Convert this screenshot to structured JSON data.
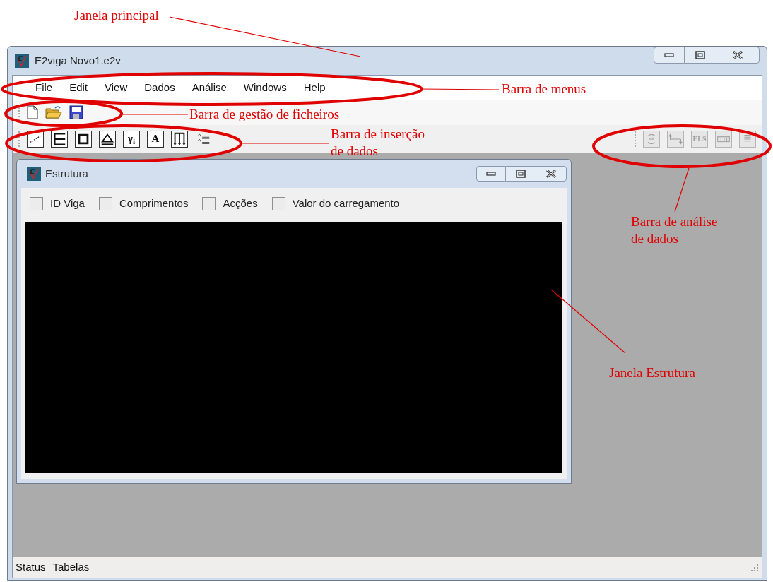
{
  "window": {
    "title": "E2viga  Novo1.e2v"
  },
  "menu": [
    "File",
    "Edit",
    "View",
    "Dados",
    "Análise",
    "Windows",
    "Help"
  ],
  "file_toolbar": [
    {
      "kind": "new"
    },
    {
      "kind": "open"
    },
    {
      "kind": "save"
    }
  ],
  "data_toolbar": [
    {
      "kind": "line"
    },
    {
      "kind": "frame"
    },
    {
      "kind": "support"
    },
    {
      "kind": "triangle"
    },
    {
      "kind": "text",
      "label": "γ$_{i}$"
    },
    {
      "kind": "text",
      "label": "A"
    },
    {
      "kind": "loads"
    },
    {
      "kind": "lines"
    }
  ],
  "analysis_toolbar": [
    {
      "kind": "cycle",
      "disabled": true
    },
    {
      "kind": "span",
      "disabled": true
    },
    {
      "kind": "text",
      "label": "ELS",
      "disabled": true
    },
    {
      "kind": "table",
      "disabled": true
    },
    {
      "kind": "list",
      "disabled": true
    }
  ],
  "child_window": {
    "title": "Estrutura",
    "checkboxes": [
      {
        "label": "ID Viga",
        "checked": false
      },
      {
        "label": "Comprimentos",
        "checked": false
      },
      {
        "label": "Acções",
        "checked": false
      },
      {
        "label": "Valor do carregamento",
        "checked": false
      }
    ]
  },
  "status_bar": [
    "Status",
    "Tabelas"
  ],
  "annotations": [
    {
      "lines": [
        "Janela principal"
      ]
    },
    {
      "lines": [
        "Barra de menus"
      ]
    },
    {
      "lines": [
        "Barra de gestão de ficheiros"
      ]
    },
    {
      "lines": [
        "Barra de inserção",
        "de dados"
      ]
    },
    {
      "lines": [
        "Barra de análise",
        "de dados"
      ]
    },
    {
      "lines": [
        "Janela Estrutura"
      ]
    }
  ]
}
